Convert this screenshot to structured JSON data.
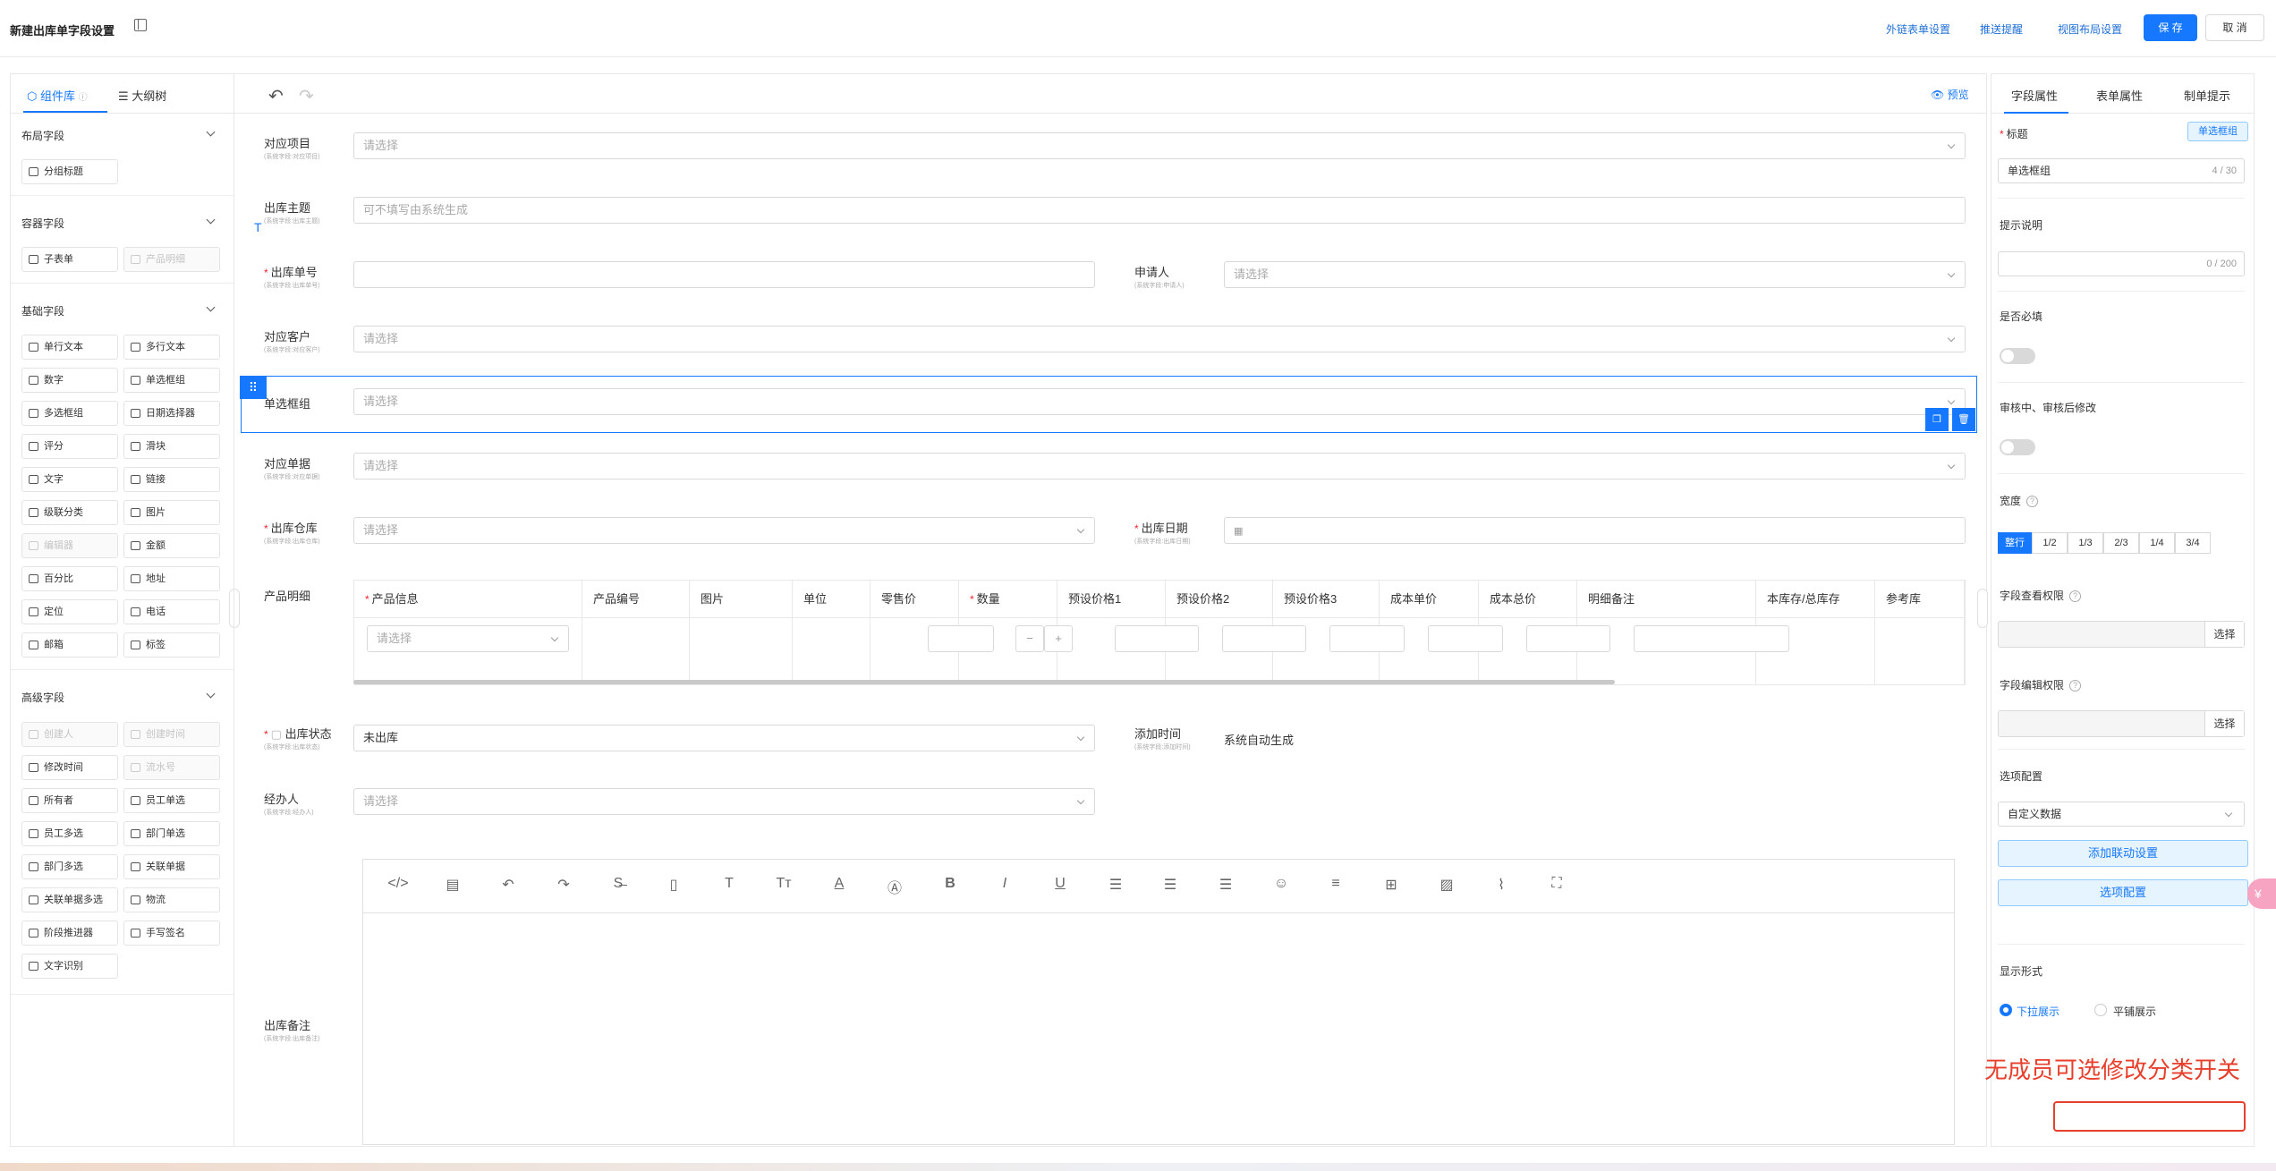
{
  "header": {
    "title": "新建出库单字段设置",
    "links": [
      "外链表单设置",
      "推送提醒",
      "视图布局设置"
    ],
    "save": "保 存",
    "cancel": "取 消"
  },
  "left_panel": {
    "tabs": [
      "组件库",
      "大纲树"
    ],
    "sections": {
      "layout": {
        "title": "布局字段",
        "items": [
          "分组标题"
        ]
      },
      "container": {
        "title": "容器字段",
        "items": [
          "子表单",
          "产品明细"
        ]
      },
      "basic": {
        "title": "基础字段",
        "items": [
          "单行文本",
          "多行文本",
          "数字",
          "单选框组",
          "多选框组",
          "日期选择器",
          "评分",
          "滑块",
          "文字",
          "链接",
          "级联分类",
          "图片",
          "编辑器",
          "金额",
          "百分比",
          "地址",
          "定位",
          "电话",
          "邮箱",
          "标签"
        ]
      },
      "advanced": {
        "title": "高级字段",
        "items": [
          "创建人",
          "创建时间",
          "修改时间",
          "流水号",
          "所有者",
          "员工单选",
          "员工多选",
          "部门单选",
          "部门多选",
          "关联单据",
          "关联单据多选",
          "物流",
          "阶段推进器",
          "手写签名",
          "文字识别"
        ]
      }
    }
  },
  "toolbar": {
    "preview": "预览"
  },
  "form": {
    "fields": {
      "project": {
        "label": "对应项目",
        "sub": "(系统字段:对应项目)",
        "placeholder": "请选择"
      },
      "subject": {
        "label": "出库主题",
        "sub": "(系统字段:出库主题)",
        "placeholder": "可不填写由系统生成"
      },
      "number": {
        "label": "出库单号",
        "sub": "(系统字段:出库单号)",
        "placeholder": ""
      },
      "applicant": {
        "label": "申请人",
        "sub": "(系统字段:申请人)",
        "placeholder": "请选择"
      },
      "customer": {
        "label": "对应客户",
        "sub": "(系统字段:对应客户)",
        "placeholder": "请选择"
      },
      "radio_group": {
        "label": "单选框组",
        "placeholder": "请选择"
      },
      "document": {
        "label": "对应单据",
        "sub": "(系统字段:对应单据)",
        "placeholder": "请选择"
      },
      "warehouse": {
        "label": "出库仓库",
        "sub": "(系统字段:出库仓库)",
        "placeholder": "请选择"
      },
      "date": {
        "label": "出库日期",
        "sub": "(系统字段:出库日期)"
      },
      "products": {
        "label": "产品明细"
      },
      "status": {
        "label": "出库状态",
        "sub": "(系统字段:出库状态)",
        "value": "未出库"
      },
      "added_time": {
        "label": "添加时间",
        "sub": "(系统字段:添加时间)",
        "value": "系统自动生成"
      },
      "handler": {
        "label": "经办人",
        "sub": "(系统字段:经办人)",
        "placeholder": "请选择"
      },
      "remark": {
        "label": "出库备注",
        "sub": "(系统字段:出库备注)"
      }
    },
    "product_table": {
      "headers": [
        "产品信息",
        "产品编号",
        "图片",
        "单位",
        "零售价",
        "数量",
        "预设价格1",
        "预设价格2",
        "预设价格3",
        "成本单价",
        "成本总价",
        "明细备注",
        "本库存/总库存",
        "参考库"
      ],
      "select_placeholder": "请选择"
    }
  },
  "right_panel": {
    "tabs": [
      "字段属性",
      "表单属性",
      "制单提示"
    ],
    "title_label": "标题",
    "title_tag": "单选框组",
    "title_value": "单选框组",
    "title_count": "4 / 30",
    "hint_label": "提示说明",
    "hint_count": "0 / 200",
    "required_label": "是否必填",
    "edit_label": "审核中、审核后修改",
    "width_label": "宽度",
    "widths": [
      "整行",
      "1/2",
      "1/3",
      "2/3",
      "1/4",
      "3/4"
    ],
    "view_perm_label": "字段查看权限",
    "edit_perm_label": "字段编辑权限",
    "select_btn": "选择",
    "options_label": "选项配置",
    "options_source": "自定义数据",
    "linkage_btn": "添加联动设置",
    "options_btn": "选项配置",
    "display_label": "显示形式",
    "display_options": [
      "下拉展示",
      "平铺展示"
    ]
  },
  "annotation": {
    "note": "无成员可选修改分类开关"
  }
}
